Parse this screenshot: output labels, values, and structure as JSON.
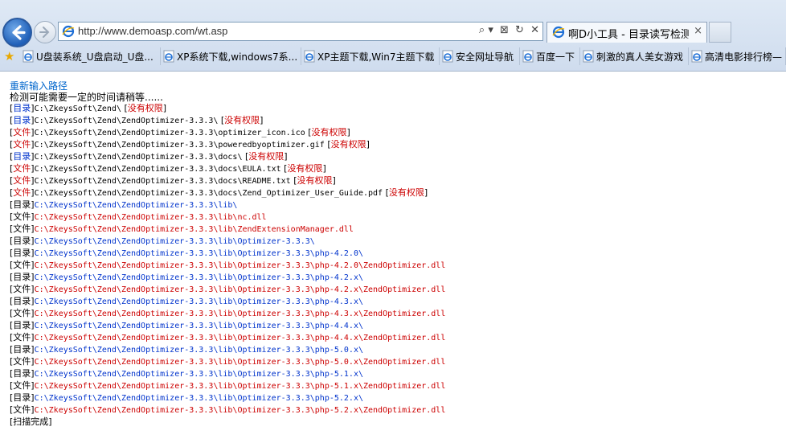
{
  "browser": {
    "address_url": "http://www.demoasp.com/wt.asp",
    "tab_title": "啊D小工具 - 目录读写检测...",
    "tab_close": "×",
    "addr_tools": [
      "⌕ ▾",
      "⊠",
      "↻",
      "✕"
    ]
  },
  "favorites": [
    {
      "label": "U盘装系统_U盘启动_U盘..."
    },
    {
      "label": "XP系统下载,windows7系..."
    },
    {
      "label": "XP主题下载,Win7主题下载"
    },
    {
      "label": "安全网址导航"
    },
    {
      "label": "百度一下"
    },
    {
      "label": "刺激的真人美女游戏"
    },
    {
      "label": "高清电影排行榜—"
    }
  ],
  "page": {
    "reenter_link": "重新输入路径",
    "wait_hint": "检测可能需要一定的时间请稍等......",
    "lines": [
      {
        "type": "目录",
        "path": "C:\\ZkeysSoft\\Zend\\",
        "status": "没有权限",
        "style": "denied"
      },
      {
        "type": "目录",
        "path": "C:\\ZkeysSoft\\Zend\\ZendOptimizer-3.3.3\\",
        "status": "没有权限",
        "style": "denied"
      },
      {
        "type": "文件",
        "path": "C:\\ZkeysSoft\\Zend\\ZendOptimizer-3.3.3\\optimizer_icon.ico",
        "status": "没有权限",
        "style": "denied"
      },
      {
        "type": "文件",
        "path": "C:\\ZkeysSoft\\Zend\\ZendOptimizer-3.3.3\\poweredbyoptimizer.gif",
        "status": "没有权限",
        "style": "denied"
      },
      {
        "type": "目录",
        "path": "C:\\ZkeysSoft\\Zend\\ZendOptimizer-3.3.3\\docs\\",
        "status": "没有权限",
        "style": "denied"
      },
      {
        "type": "文件",
        "path": "C:\\ZkeysSoft\\Zend\\ZendOptimizer-3.3.3\\docs\\EULA.txt",
        "status": "没有权限",
        "style": "denied"
      },
      {
        "type": "文件",
        "path": "C:\\ZkeysSoft\\Zend\\ZendOptimizer-3.3.3\\docs\\README.txt",
        "status": "没有权限",
        "style": "denied"
      },
      {
        "type": "文件",
        "path": "C:\\ZkeysSoft\\Zend\\ZendOptimizer-3.3.3\\docs\\Zend_Optimizer_User_Guide.pdf",
        "status": "没有权限",
        "style": "denied"
      },
      {
        "type": "目录",
        "path": "C:\\ZkeysSoft\\Zend\\ZendOptimizer-3.3.3\\lib\\",
        "status": "",
        "style": "dir"
      },
      {
        "type": "文件",
        "path": "C:\\ZkeysSoft\\Zend\\ZendOptimizer-3.3.3\\lib\\nc.dll",
        "status": "",
        "style": "file"
      },
      {
        "type": "文件",
        "path": "C:\\ZkeysSoft\\Zend\\ZendOptimizer-3.3.3\\lib\\ZendExtensionManager.dll",
        "status": "",
        "style": "file"
      },
      {
        "type": "目录",
        "path": "C:\\ZkeysSoft\\Zend\\ZendOptimizer-3.3.3\\lib\\Optimizer-3.3.3\\",
        "status": "",
        "style": "dir"
      },
      {
        "type": "目录",
        "path": "C:\\ZkeysSoft\\Zend\\ZendOptimizer-3.3.3\\lib\\Optimizer-3.3.3\\php-4.2.0\\",
        "status": "",
        "style": "dir"
      },
      {
        "type": "文件",
        "path": "C:\\ZkeysSoft\\Zend\\ZendOptimizer-3.3.3\\lib\\Optimizer-3.3.3\\php-4.2.0\\ZendOptimizer.dll",
        "status": "",
        "style": "file"
      },
      {
        "type": "目录",
        "path": "C:\\ZkeysSoft\\Zend\\ZendOptimizer-3.3.3\\lib\\Optimizer-3.3.3\\php-4.2.x\\",
        "status": "",
        "style": "dir"
      },
      {
        "type": "文件",
        "path": "C:\\ZkeysSoft\\Zend\\ZendOptimizer-3.3.3\\lib\\Optimizer-3.3.3\\php-4.2.x\\ZendOptimizer.dll",
        "status": "",
        "style": "file"
      },
      {
        "type": "目录",
        "path": "C:\\ZkeysSoft\\Zend\\ZendOptimizer-3.3.3\\lib\\Optimizer-3.3.3\\php-4.3.x\\",
        "status": "",
        "style": "dir"
      },
      {
        "type": "文件",
        "path": "C:\\ZkeysSoft\\Zend\\ZendOptimizer-3.3.3\\lib\\Optimizer-3.3.3\\php-4.3.x\\ZendOptimizer.dll",
        "status": "",
        "style": "file"
      },
      {
        "type": "目录",
        "path": "C:\\ZkeysSoft\\Zend\\ZendOptimizer-3.3.3\\lib\\Optimizer-3.3.3\\php-4.4.x\\",
        "status": "",
        "style": "dir"
      },
      {
        "type": "文件",
        "path": "C:\\ZkeysSoft\\Zend\\ZendOptimizer-3.3.3\\lib\\Optimizer-3.3.3\\php-4.4.x\\ZendOptimizer.dll",
        "status": "",
        "style": "file"
      },
      {
        "type": "目录",
        "path": "C:\\ZkeysSoft\\Zend\\ZendOptimizer-3.3.3\\lib\\Optimizer-3.3.3\\php-5.0.x\\",
        "status": "",
        "style": "dir"
      },
      {
        "type": "文件",
        "path": "C:\\ZkeysSoft\\Zend\\ZendOptimizer-3.3.3\\lib\\Optimizer-3.3.3\\php-5.0.x\\ZendOptimizer.dll",
        "status": "",
        "style": "file"
      },
      {
        "type": "目录",
        "path": "C:\\ZkeysSoft\\Zend\\ZendOptimizer-3.3.3\\lib\\Optimizer-3.3.3\\php-5.1.x\\",
        "status": "",
        "style": "dir"
      },
      {
        "type": "文件",
        "path": "C:\\ZkeysSoft\\Zend\\ZendOptimizer-3.3.3\\lib\\Optimizer-3.3.3\\php-5.1.x\\ZendOptimizer.dll",
        "status": "",
        "style": "file"
      },
      {
        "type": "目录",
        "path": "C:\\ZkeysSoft\\Zend\\ZendOptimizer-3.3.3\\lib\\Optimizer-3.3.3\\php-5.2.x\\",
        "status": "",
        "style": "dir"
      },
      {
        "type": "文件",
        "path": "C:\\ZkeysSoft\\Zend\\ZendOptimizer-3.3.3\\lib\\Optimizer-3.3.3\\php-5.2.x\\ZendOptimizer.dll",
        "status": "",
        "style": "file"
      }
    ],
    "done_text": "[扫描完成]"
  },
  "colors": {
    "dir_blue": "#0033cc",
    "file_red": "#cc0000",
    "link_blue": "#0066cc"
  }
}
